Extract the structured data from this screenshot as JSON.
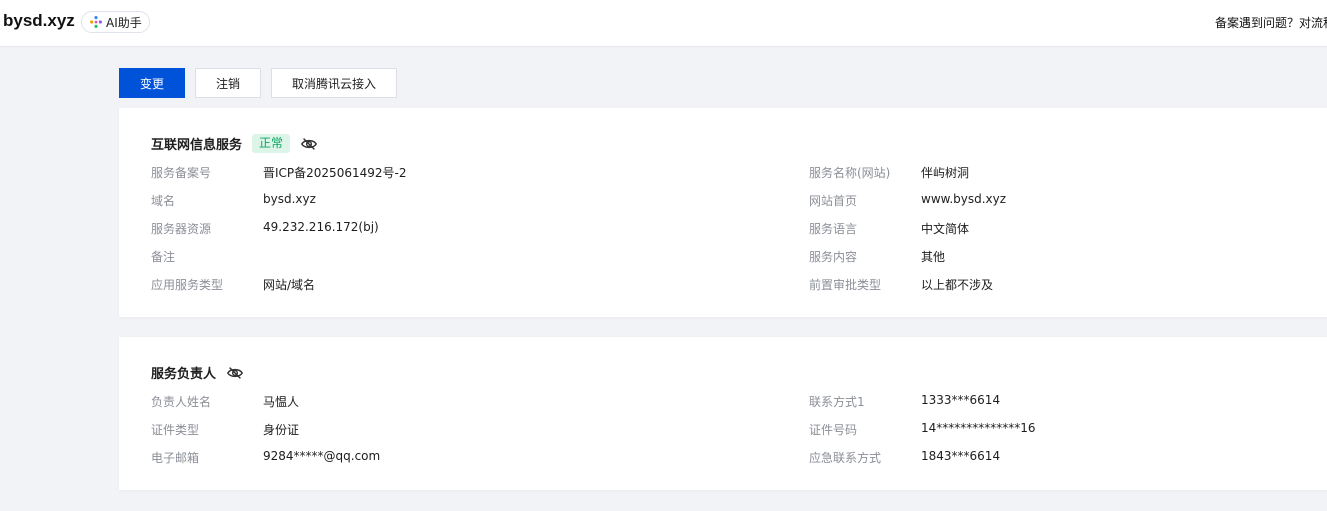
{
  "header": {
    "domain": "bysd.xyz",
    "ai_assistant": "AI助手",
    "help_text": "备案遇到问题？对流程"
  },
  "actions": {
    "change": "变更",
    "cancel": "注销",
    "cancel_tencent_access": "取消腾讯云接入"
  },
  "internet_service": {
    "title": "互联网信息服务",
    "status": "正常",
    "left": [
      {
        "label": "服务备案号",
        "value": "晋ICP备2025061492号-2"
      },
      {
        "label": "域名",
        "value": "bysd.xyz"
      },
      {
        "label": "服务器资源",
        "value": "49.232.216.172(bj)"
      },
      {
        "label": "备注",
        "value": ""
      },
      {
        "label": "应用服务类型",
        "value": "网站/域名"
      }
    ],
    "right": [
      {
        "label": "服务名称(网站)",
        "value": "伴屿树洞"
      },
      {
        "label": "网站首页",
        "value": "www.bysd.xyz"
      },
      {
        "label": "服务语言",
        "value": "中文简体"
      },
      {
        "label": "服务内容",
        "value": "其他"
      },
      {
        "label": "前置审批类型",
        "value": "以上都不涉及"
      }
    ]
  },
  "service_owner": {
    "title": "服务负责人",
    "left": [
      {
        "label": "负责人姓名",
        "value": "马愠人"
      },
      {
        "label": "证件类型",
        "value": "身份证"
      },
      {
        "label": "电子邮箱",
        "value": "9284*****@qq.com"
      }
    ],
    "right": [
      {
        "label": "联系方式1",
        "value": "1333***6614"
      },
      {
        "label": "证件号码",
        "value": "14**************16"
      },
      {
        "label": "应急联系方式",
        "value": "1843***6614"
      }
    ]
  },
  "colors": {
    "primary": "#0052d9",
    "status_green": "#0aa563",
    "label_gray": "#8b8f97"
  }
}
